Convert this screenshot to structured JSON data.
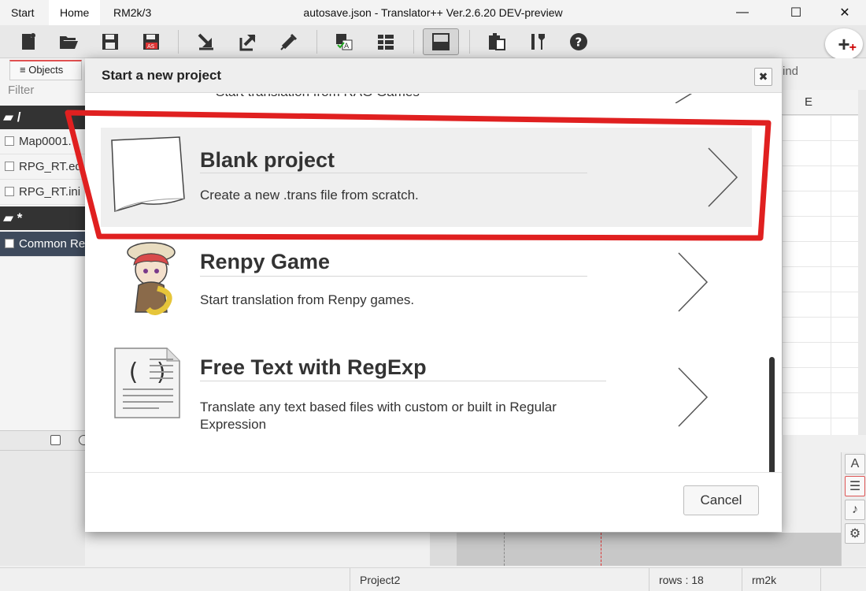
{
  "titlebar": {
    "tabs": [
      {
        "label": "Start"
      },
      {
        "label": "Home"
      },
      {
        "label": "RM2k/3"
      }
    ],
    "title": "autosave.json - Translator++ Ver.2.6.20 DEV-preview",
    "minimize": "—",
    "maximize": "☐",
    "close": "✕"
  },
  "toolbar": {
    "buttons": [
      "new-project",
      "open-project",
      "save",
      "save-as",
      "import",
      "export",
      "inject",
      "translate",
      "batch",
      "layout",
      "paste",
      "tools",
      "help"
    ],
    "add_label": "+",
    "add_sub": "+"
  },
  "left_panel": {
    "tab_label": "Objects",
    "filter_label": "Filter",
    "folder_root": "/",
    "files": [
      "Map0001.",
      "RPG_RT.ed",
      "RPG_RT.ini"
    ],
    "folder_star": "*",
    "selected_file": "Common Re"
  },
  "right_panel": {
    "find_label": "ind",
    "column_label": "E"
  },
  "modal": {
    "title": "Start a new project",
    "close_label": "✖",
    "peek_text": "Start translation from RAG Games",
    "options": [
      {
        "title": "Blank project",
        "description": "Create a new .trans file from scratch."
      },
      {
        "title": "Renpy Game",
        "description": "Start translation from Renpy games."
      },
      {
        "title": "Free Text with RegExp",
        "description": "Translate any text based files with custom or built in Regular Expression"
      }
    ],
    "cancel_label": "Cancel"
  },
  "statusbar": {
    "project": "Project2",
    "rows": "rows : 18",
    "engine": "rm2k"
  },
  "colors": {
    "annotation_red": "#e02020",
    "selected_row": "#3e4a5c",
    "folder_row": "#333333"
  }
}
